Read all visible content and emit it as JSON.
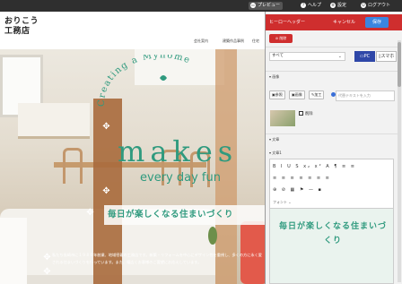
{
  "topbar": {
    "preview_label": "プレビュー",
    "help_label": "ヘルプ",
    "settings_label": "設定",
    "logout_label": "ログアウト"
  },
  "site": {
    "logo_line1": "おりこう",
    "logo_line2": "工務店",
    "nav": [
      "会社案内",
      "建築作品事例",
      "住宅"
    ],
    "arc_text": "Creating a Myhome",
    "brand": "makes",
    "subbrand": "every day fun",
    "tagline": "毎日が楽しくなる住まいづくり",
    "description": "私たち長崎市に１９８０年創業、地域密着の工務店です。新築・リフォームを中心にデザイン性を重視し、多くの方に永く愛される住まいづくりを行っています。また、幅広くお客様のご要望にお応えしています。"
  },
  "panel": {
    "title": "ヒーローヘッダー",
    "cancel_label": "キャンセル",
    "save_label": "保存",
    "delete_label": "削除",
    "device_select": "すべて",
    "pc_label": "PC",
    "sp_label": "スマホ",
    "section_image": "画像",
    "ref_button": "参照",
    "library_button": "画像",
    "edit_button": "加工",
    "alt_placeholder": "代替テキストを入力",
    "delete_checkbox_label": "削除",
    "section_text": "文章",
    "text_field_label": "文章1",
    "toolbar_row1": "B I U S x₂ x² A ¶ ≡ ≡",
    "toolbar_row2": "≡ ≡ ≡ ≡ ≡ ≡ ≡",
    "toolbar_row3": "⊕ ⊘ ▦ ⚑ — ▪",
    "font_label": "フォント",
    "editor_text": "毎日が楽しくなる住まいづくり"
  },
  "colors": {
    "accent_red": "#cf2e2e",
    "brand_green": "#2f9a7e",
    "save_blue": "#3a85e0",
    "pc_blue": "#2f47a8"
  }
}
